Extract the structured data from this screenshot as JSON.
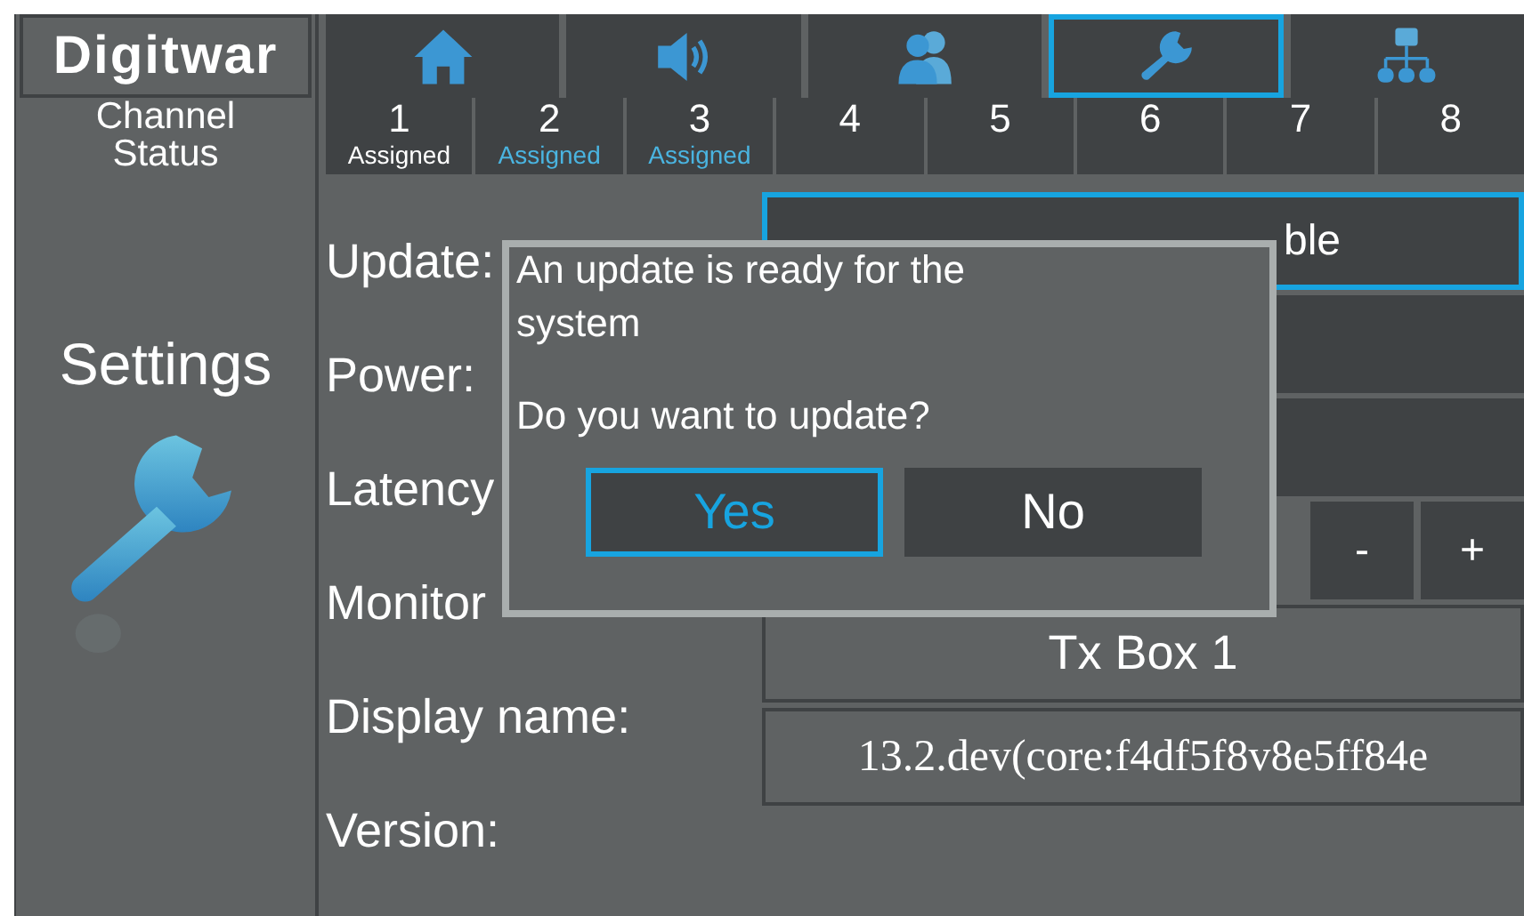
{
  "logo": {
    "text": "Digitwar"
  },
  "nav_tabs": [
    {
      "kind": "home",
      "selected": false
    },
    {
      "kind": "speaker",
      "selected": false
    },
    {
      "kind": "people",
      "selected": false
    },
    {
      "kind": "wrench",
      "selected": true
    },
    {
      "kind": "network",
      "selected": false
    }
  ],
  "channel_status": {
    "line1": "Channel",
    "line2": "Status"
  },
  "channels": [
    {
      "number": "1",
      "status": "Assigned",
      "highlighted": false
    },
    {
      "number": "2",
      "status": "Assigned",
      "highlighted": true
    },
    {
      "number": "3",
      "status": "Assigned",
      "highlighted": true
    },
    {
      "number": "4"
    },
    {
      "number": "5"
    },
    {
      "number": "6"
    },
    {
      "number": "7"
    },
    {
      "number": "8"
    }
  ],
  "sidebar": {
    "title": "Settings"
  },
  "settings": {
    "labels": [
      "Update:",
      "Power:",
      "Latency",
      "Monitor",
      "Display name:",
      "Version:"
    ],
    "update_value": "ble",
    "volume_buttons": [
      "-",
      "+"
    ],
    "display_name": "Tx Box 1",
    "version": "13.2.dev(core:f4df5f8v8e5ff84e"
  },
  "dialog": {
    "message": "An update is ready for the system",
    "question": "Do you want to update?",
    "buttons": [
      {
        "label": "Yes",
        "selected": true
      },
      {
        "label": "No",
        "selected": false
      }
    ]
  }
}
